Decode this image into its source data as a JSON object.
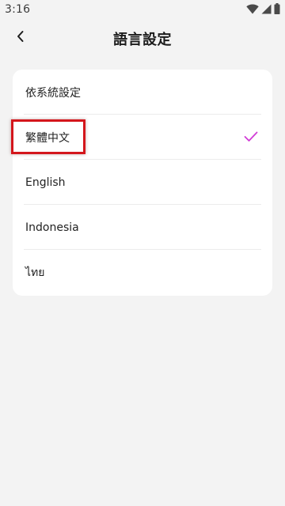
{
  "status_bar": {
    "time": "3:16",
    "icons": [
      "wifi-icon",
      "cellular-signal-icon",
      "battery-icon"
    ]
  },
  "header": {
    "title": "語言設定",
    "back_icon": "chevron-left-icon"
  },
  "languages": [
    {
      "label": "依系統設定",
      "selected": false
    },
    {
      "label": "繁體中文",
      "selected": true
    },
    {
      "label": "English",
      "selected": false
    },
    {
      "label": "Indonesia",
      "selected": false
    },
    {
      "label": "ไทย",
      "selected": false
    }
  ],
  "colors": {
    "accent": "#d13cd6",
    "highlight": "#d4161c",
    "background": "#f3f3f3",
    "card": "#ffffff"
  }
}
